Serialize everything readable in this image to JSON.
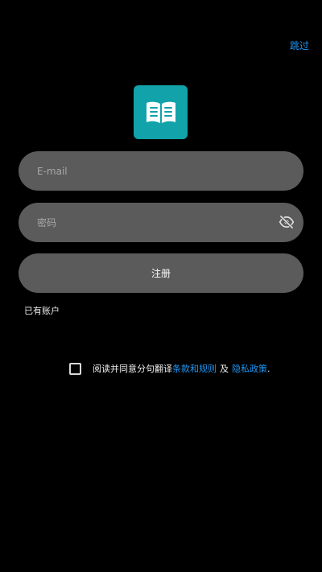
{
  "header": {
    "skip_label": "跳过"
  },
  "logo": {
    "icon": "open-book-icon",
    "bg_color": "#11a2aa"
  },
  "form": {
    "email_placeholder": "E-mail",
    "email_value": "",
    "password_placeholder": "密码",
    "password_value": "",
    "password_toggle_icon": "eye-off-icon",
    "register_label": "注册",
    "has_account_label": "已有账户"
  },
  "agreement": {
    "prefix": "阅读并同意分句翻译",
    "terms_link": "条款和规则",
    "conjunction": "及",
    "privacy_link": "隐私政策",
    "suffix": ".",
    "link_color": "#2196f3",
    "checked": false
  }
}
